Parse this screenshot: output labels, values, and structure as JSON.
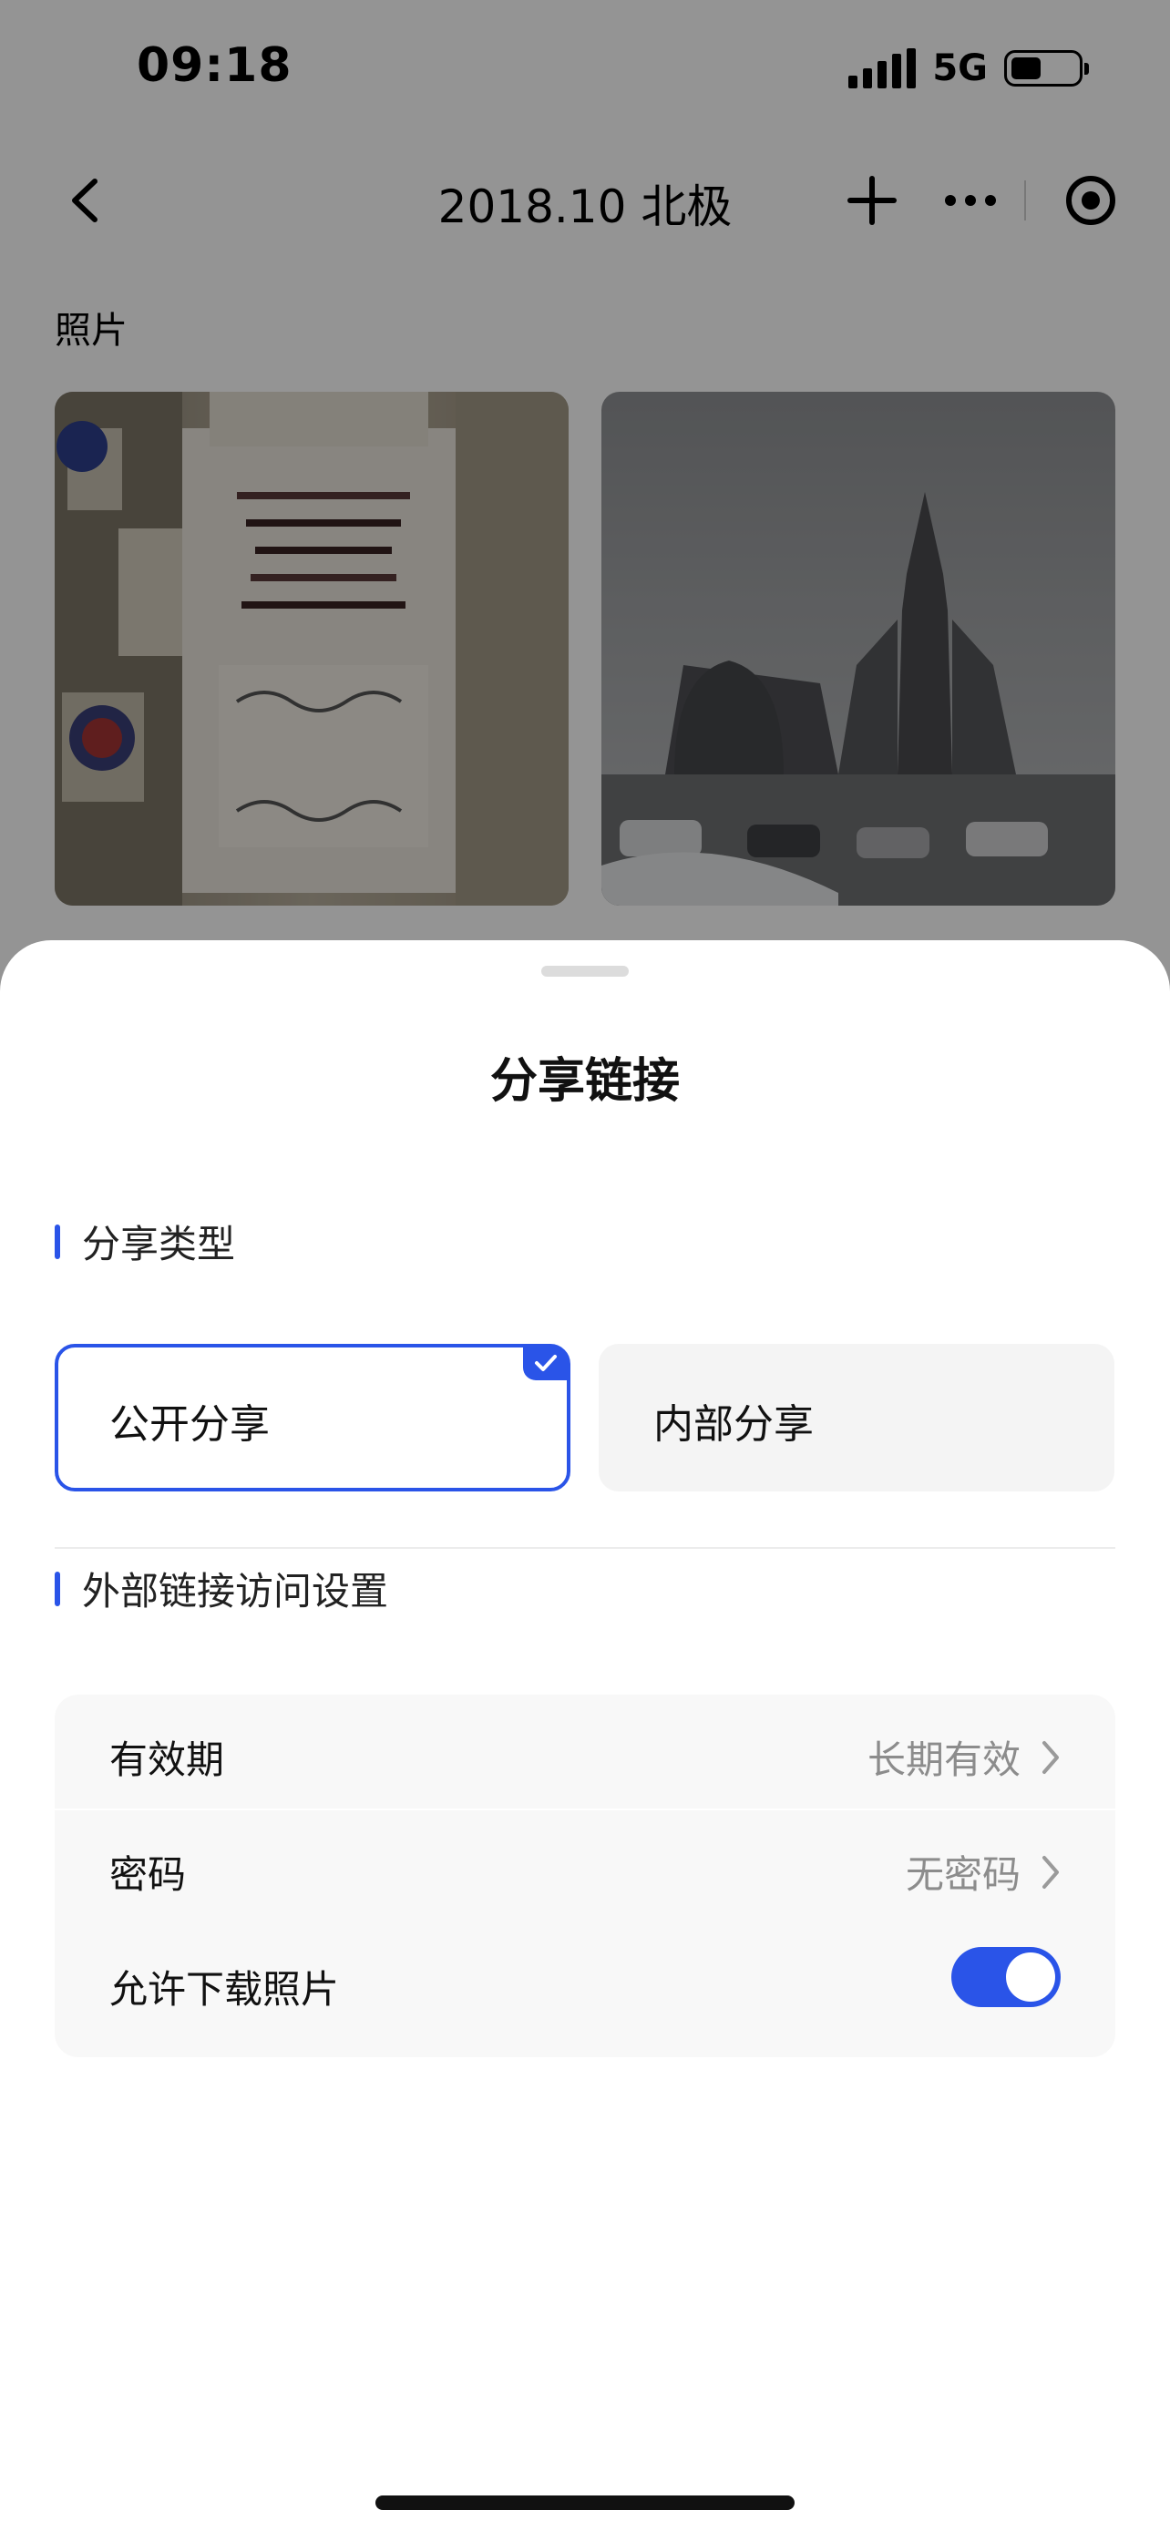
{
  "status_bar": {
    "time": "09:18",
    "network": "5G",
    "battery_level": 0.45
  },
  "nav": {
    "title": "2018.10 北极",
    "back_icon": "chevron-left-icon",
    "add_icon": "plus-icon",
    "more_icon": "more-dots-icon",
    "target_icon": "record-circle-icon"
  },
  "album": {
    "section_label": "照片"
  },
  "sheet": {
    "title": "分享链接",
    "share_type_heading": "分享类型",
    "share_options": [
      {
        "label": "公开分享",
        "selected": true
      },
      {
        "label": "内部分享",
        "selected": false
      }
    ],
    "access_heading": "外部链接访问设置",
    "settings": {
      "expiry_label": "有效期",
      "expiry_value": "长期有效",
      "password_label": "密码",
      "password_value": "无密码",
      "download_label": "允许下载照片",
      "download_enabled": true
    }
  },
  "colors": {
    "accent": "#2a54e8",
    "overlay": "rgba(0,0,0,0.42)",
    "card_bg": "#f8f8f8",
    "muted_text": "#8c8c8c"
  }
}
